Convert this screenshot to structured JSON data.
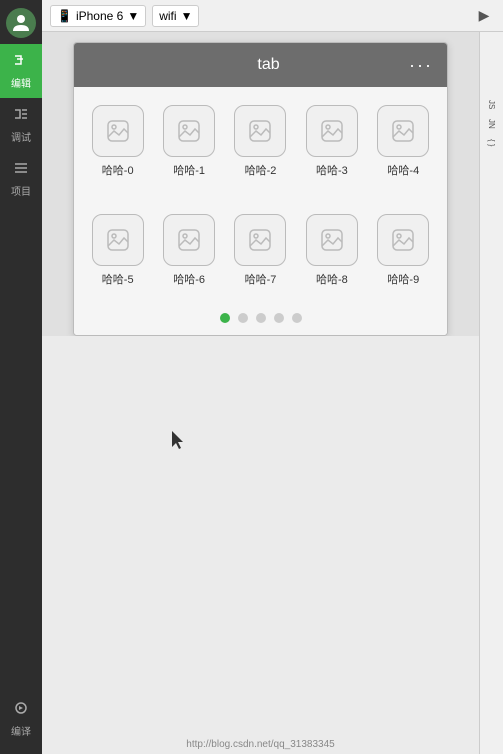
{
  "topbar": {
    "device_label": "iPhone 6",
    "device_icon": "▼",
    "wifi_label": "wifi",
    "wifi_icon": "▼"
  },
  "sidebar": {
    "avatar_alt": "avatar",
    "items": [
      {
        "id": "code",
        "label": "编辑",
        "icon": "</>",
        "active": true
      },
      {
        "id": "debug",
        "label": "调试",
        "icon": "</>"
      },
      {
        "id": "project",
        "label": "项目",
        "icon": "☰"
      }
    ],
    "bottom_items": [
      {
        "id": "compile",
        "label": "编译",
        "icon": "⚙"
      }
    ]
  },
  "phone": {
    "tab_header": {
      "title": "tab",
      "dots": "···"
    },
    "grid_rows": [
      [
        {
          "label": "哈哈-0"
        },
        {
          "label": "哈哈-1"
        },
        {
          "label": "哈哈-2"
        },
        {
          "label": "哈哈-3"
        },
        {
          "label": "哈哈-4"
        }
      ],
      [
        {
          "label": "哈哈-5"
        },
        {
          "label": "哈哈-6"
        },
        {
          "label": "哈哈-7"
        },
        {
          "label": "哈哈-8"
        },
        {
          "label": "哈哈-9"
        }
      ]
    ],
    "page_dots": [
      {
        "active": true
      },
      {
        "active": false
      },
      {
        "active": false
      },
      {
        "active": false
      },
      {
        "active": false
      }
    ]
  },
  "right_panel": {
    "labels": [
      "JS",
      "JN",
      "{ }"
    ]
  },
  "watermark": "http://blog.csdn.net/qq_31383345"
}
